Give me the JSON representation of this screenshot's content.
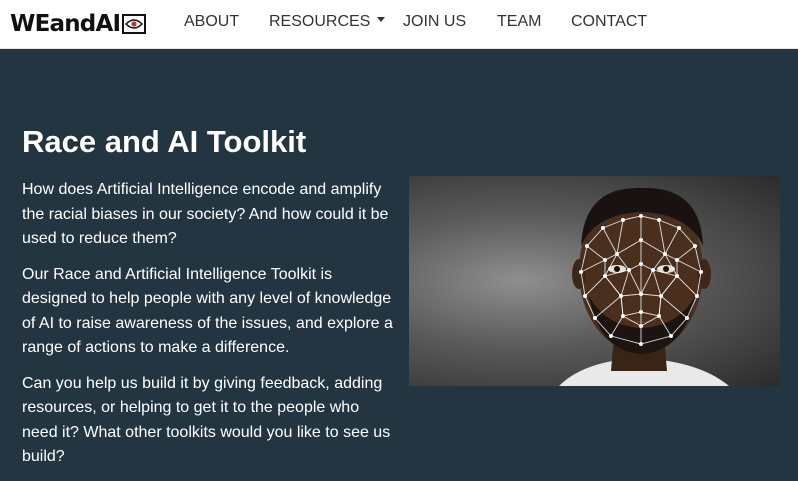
{
  "brand": {
    "logo_text": "WEandAI"
  },
  "nav": {
    "about": "ABOUT",
    "resources": "RESOURCES",
    "join_us": "JOIN US",
    "team": "TEAM",
    "contact": "CONTACT"
  },
  "main": {
    "title": "Race and AI Toolkit",
    "paragraphs": [
      "How does Artificial Intelligence encode and amplify the racial biases in our society? And how could it be used to reduce them?",
      "Our Race and Artificial Intelligence Toolkit is designed to help people with any level of knowledge of AI to raise awareness of the issues, and explore a range of actions to make a difference.",
      "Can you help us build it by giving feedback, adding resources, or helping to get it to the people who need it? What other toolkits would you like to see us build?"
    ]
  },
  "colors": {
    "page_background": "#243542",
    "navbar_background": "#ffffff",
    "text": "#ffffff"
  },
  "icons": {
    "logo_eye": "eye-icon",
    "resources_caret": "caret-down-icon"
  }
}
